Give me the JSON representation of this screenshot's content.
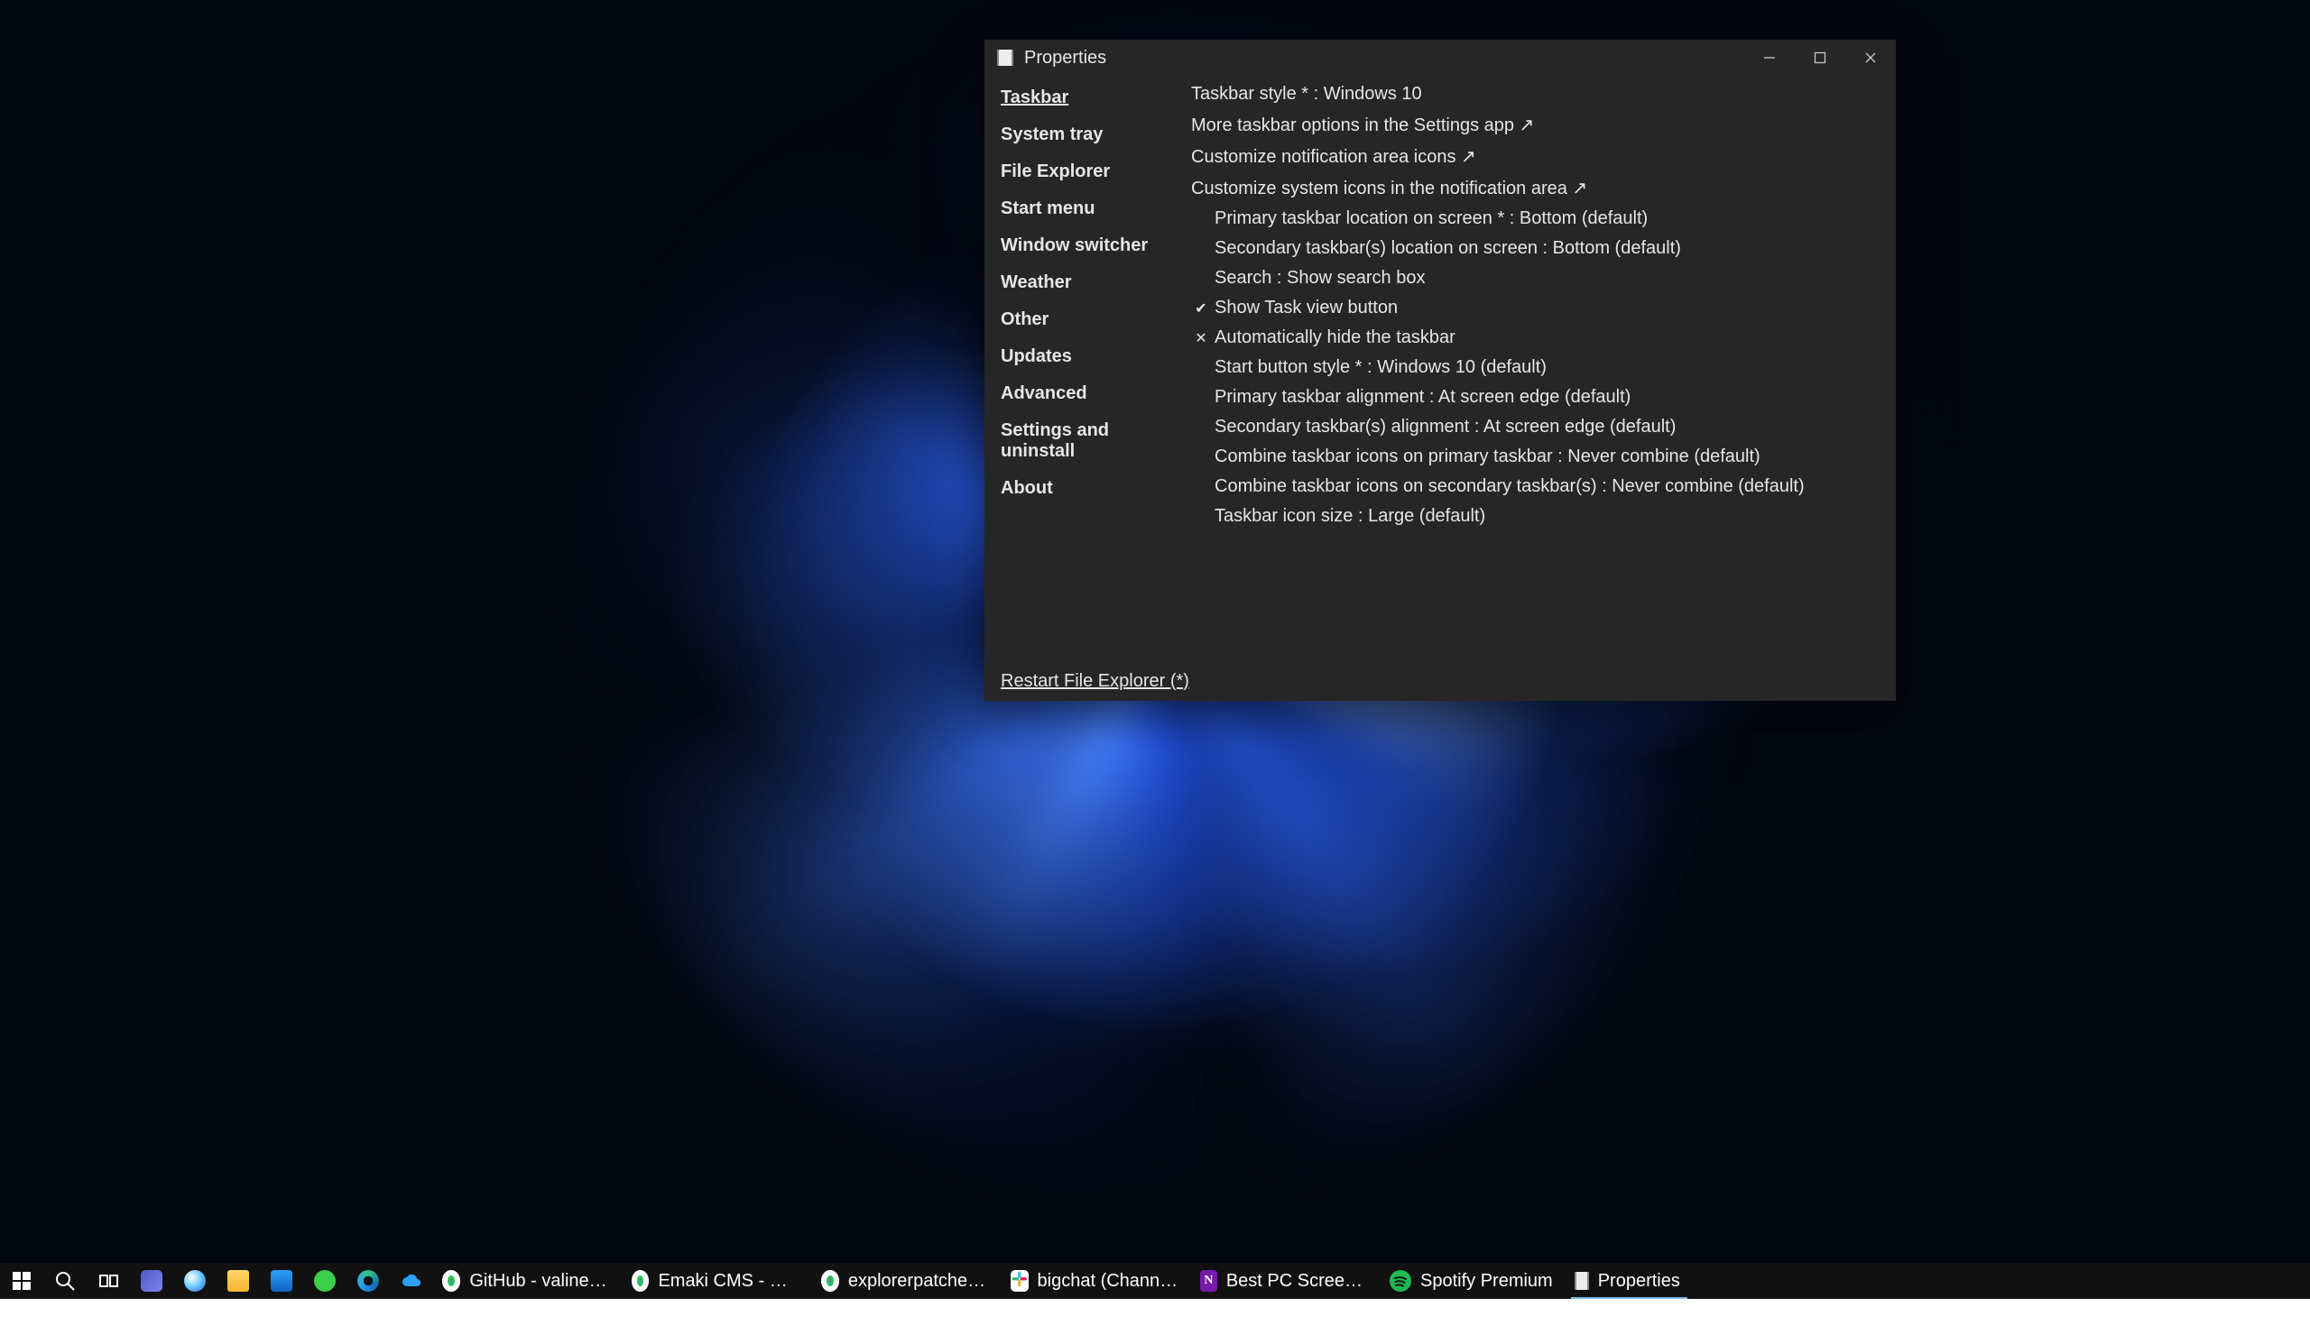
{
  "window": {
    "title": "Properties",
    "restart_label": "Restart File Explorer (*)"
  },
  "sidebar": {
    "items": [
      {
        "id": "taskbar",
        "label": "Taskbar",
        "active": true
      },
      {
        "id": "system-tray",
        "label": "System tray"
      },
      {
        "id": "file-explorer",
        "label": "File Explorer"
      },
      {
        "id": "start-menu",
        "label": "Start menu"
      },
      {
        "id": "window-switcher",
        "label": "Window switcher"
      },
      {
        "id": "weather",
        "label": "Weather"
      },
      {
        "id": "other",
        "label": "Other"
      },
      {
        "id": "updates",
        "label": "Updates"
      },
      {
        "id": "advanced",
        "label": "Advanced"
      },
      {
        "id": "settings",
        "label": "Settings and uninstall"
      },
      {
        "id": "about",
        "label": "About"
      }
    ]
  },
  "content": {
    "items": [
      {
        "label": "Taskbar style * : Windows 10",
        "indent": false
      },
      {
        "label": "More taskbar options in the Settings app",
        "indent": false,
        "link": true
      },
      {
        "label": "Customize notification area icons",
        "indent": false,
        "link": true
      },
      {
        "label": "Customize system icons in the notification area",
        "indent": false,
        "link": true
      },
      {
        "label": "Primary taskbar location on screen * : Bottom (default)",
        "indent": true
      },
      {
        "label": "Secondary taskbar(s) location on screen : Bottom (default)",
        "indent": true
      },
      {
        "label": "Search : Show search box",
        "indent": true
      },
      {
        "label": "Show Task view button",
        "indent": true,
        "mark": "check"
      },
      {
        "label": "Automatically hide the taskbar",
        "indent": true,
        "mark": "cross"
      },
      {
        "label": "Start button style * : Windows 10 (default)",
        "indent": true
      },
      {
        "label": "Primary taskbar alignment : At screen edge (default)",
        "indent": true
      },
      {
        "label": "Secondary taskbar(s) alignment : At screen edge (default)",
        "indent": true
      },
      {
        "label": "Combine taskbar icons on primary taskbar : Never combine (default)",
        "indent": true
      },
      {
        "label": "Combine taskbar icons on secondary taskbar(s) : Never combine (default)",
        "indent": true
      },
      {
        "label": "Taskbar icon size : Large (default)",
        "indent": true
      }
    ]
  },
  "taskbar": {
    "pinned": [
      {
        "id": "start",
        "name": "start-icon"
      },
      {
        "id": "search",
        "name": "search-icon"
      },
      {
        "id": "task-view",
        "name": "task-view-icon"
      },
      {
        "id": "teams",
        "name": "teams-icon"
      },
      {
        "id": "copilot",
        "name": "dot-icon"
      },
      {
        "id": "explorer",
        "name": "folder-icon"
      },
      {
        "id": "mail",
        "name": "mail-icon"
      },
      {
        "id": "xbox",
        "name": "green-circle-icon"
      },
      {
        "id": "edge",
        "name": "edge-icon"
      },
      {
        "id": "onedrive",
        "name": "cloud-icon"
      }
    ],
    "apps": [
      {
        "id": "github",
        "label": "GitHub - valinet/Ex...",
        "icon": "chrome-icon",
        "color": "#22c55e"
      },
      {
        "id": "emaki",
        "label": "Emaki CMS - Googl...",
        "icon": "chrome-icon",
        "color": "#22c55e"
      },
      {
        "id": "explpat",
        "label": "explorerpatcher - G...",
        "icon": "chrome-icon",
        "color": "#22c55e"
      },
      {
        "id": "bigchat",
        "label": "bigchat (Channel) - ...",
        "icon": "slack-icon",
        "color": "#e01e5a"
      },
      {
        "id": "recorder",
        "label": "Best PC Screen Rec...",
        "icon": "onenote-icon",
        "color": "#7719aa"
      },
      {
        "id": "spotify",
        "label": "Spotify Premium",
        "icon": "spotify-icon",
        "color": "#1db954"
      },
      {
        "id": "props",
        "label": "Properties",
        "icon": "props-icon",
        "color": "#ededed",
        "active": true
      }
    ]
  }
}
